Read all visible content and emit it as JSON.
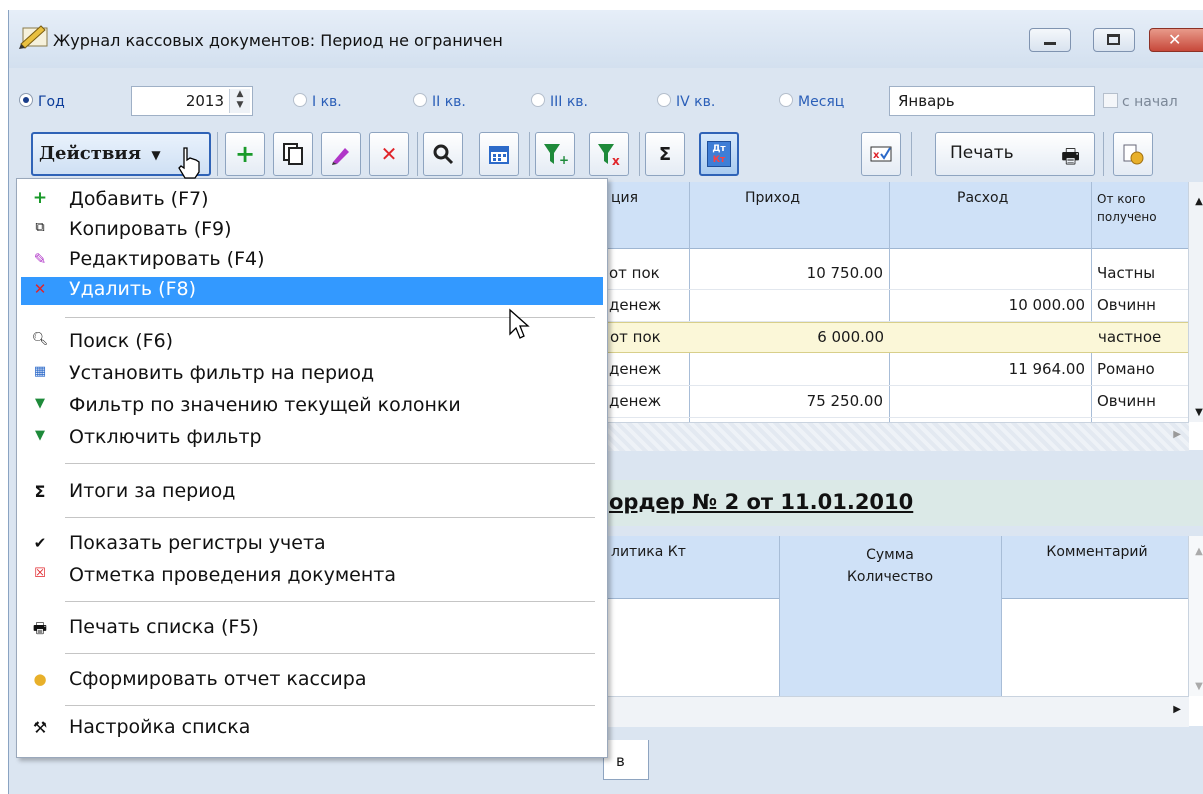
{
  "window": {
    "title": "Журнал кассовых документов: Период не ограничен",
    "controls": [
      "minimize-icon",
      "maximize-icon",
      "close-icon"
    ]
  },
  "period": {
    "year_label": "Год",
    "year_value": "2013",
    "q1": "I кв.",
    "q2": "II кв.",
    "q3": "III кв.",
    "q4": "IV кв.",
    "month_label": "Месяц",
    "month_value": "Январь",
    "from_start_label": "с начал",
    "selected": "year"
  },
  "toolbar": {
    "actions_label": "Действия",
    "print_label": "Печать",
    "sum_symbol": "Σ",
    "dtkt_top": "Дт",
    "dtkt_bottom": "Кт"
  },
  "grid": {
    "columns": [
      "ция",
      "Приход",
      "Расход",
      "От кого",
      "получено"
    ],
    "rows": [
      {
        "op": "от пок",
        "in": "10 750.00",
        "out": "",
        "from": "Частны"
      },
      {
        "op": "денеж",
        "in": "",
        "out": "10 000.00",
        "from": "Овчинн"
      },
      {
        "op": "от пок",
        "in": "6 000.00",
        "out": "",
        "from": "частное"
      },
      {
        "op": "денеж",
        "in": "",
        "out": "11 964.00",
        "from": "Романо"
      },
      {
        "op": "денеж",
        "in": "75 250.00",
        "out": "",
        "from": "Овчинн"
      }
    ]
  },
  "document": {
    "title": "ордер № 2 от 11.01.2010",
    "col1": "литика Кт",
    "col2_line1": "Сумма",
    "col2_line2": "Количество",
    "col3": "Комментарий",
    "tab_label": "в"
  },
  "menu": {
    "items": [
      {
        "icon": "plus-icon",
        "label": "Добавить (F7)"
      },
      {
        "icon": "copy-icon",
        "label": "Копировать (F9)"
      },
      {
        "icon": "edit-pen-icon",
        "label": "Редактировать (F4)"
      },
      {
        "icon": "delete-x-icon",
        "label": "Удалить (F8)"
      },
      {
        "icon": "search-icon",
        "label": "Поиск (F6)"
      },
      {
        "icon": "calendar-icon",
        "label": "Установить фильтр на период"
      },
      {
        "icon": "filter-add-icon",
        "label": "Фильтр по значению текущей колонки"
      },
      {
        "icon": "filter-remove-icon",
        "label": "Отключить фильтр"
      },
      {
        "icon": "sigma-icon",
        "label": "Итоги за период"
      },
      {
        "icon": "checkmark-icon",
        "label": "Показать регистры учета"
      },
      {
        "icon": "posting-mark-icon",
        "label": "Отметка проведения документа"
      },
      {
        "icon": "printer-icon",
        "label": "Печать списка (F5)"
      },
      {
        "icon": "cashier-report-icon",
        "label": "Сформировать отчет кассира"
      },
      {
        "icon": "tools-icon",
        "label": "Настройка списка"
      }
    ],
    "highlighted": "Удалить (F8)"
  },
  "colors": {
    "menu_highlight": "#3399ff",
    "header_blue": "#cfe1f7",
    "selected_row": "#fbf7d8",
    "window_bg": "#dbe5f1"
  }
}
